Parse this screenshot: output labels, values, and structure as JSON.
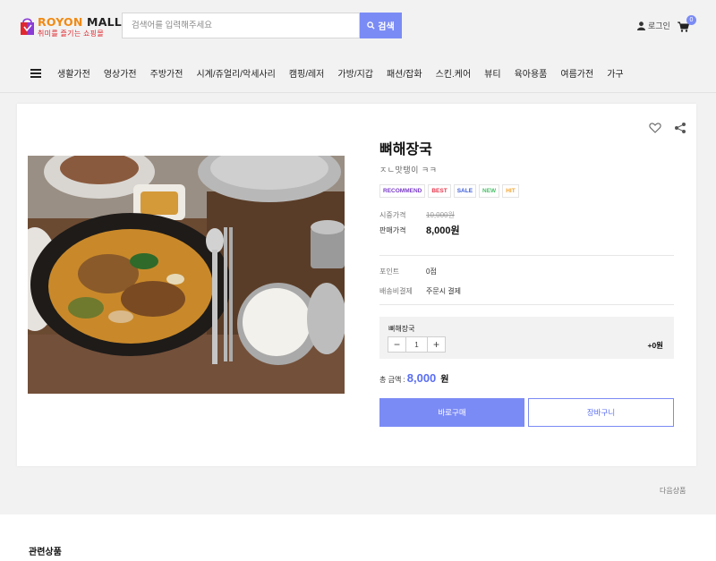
{
  "logo": {
    "title_part1": "ROYON",
    "title_part2": " MALL",
    "tagline": "취미를 즐기는 쇼핑몰"
  },
  "search": {
    "placeholder": "검색어를 입력해주세요",
    "button": "검색"
  },
  "user": {
    "login": "로그인",
    "cart_count": "0"
  },
  "nav": {
    "items": [
      "생활가전",
      "영상가전",
      "주방가전",
      "시계/쥬얼리/악세사리",
      "캠핑/레저",
      "가방/지갑",
      "패션/잡화",
      "스킨.케어",
      "뷰티",
      "육아용품",
      "여름가전",
      "가구"
    ]
  },
  "product": {
    "name": "뼈해장국",
    "subtitle": "ㅈㄴ맛탱이 ㅋㅋ",
    "badges": [
      {
        "text": "RECOMMEND",
        "color": "#7b3bc9"
      },
      {
        "text": "BEST",
        "color": "#e8344a"
      },
      {
        "text": "SALE",
        "color": "#3b5bd8"
      },
      {
        "text": "NEW",
        "color": "#4cc06a"
      },
      {
        "text": "HIT",
        "color": "#f2a533"
      }
    ],
    "market_price_label": "시중가격",
    "market_price": "10,000원",
    "sale_price_label": "판매가격",
    "sale_price": "8,000원",
    "point_label": "포인트",
    "point": "0점",
    "shipping_label": "배송비결제",
    "shipping": "주문시 결제",
    "option": {
      "name": "뼈해장국",
      "quantity": "1",
      "extra_price": "+0원"
    },
    "total_label": "총 금액 :",
    "total_amount": "8,000",
    "total_unit": "원",
    "buy_button": "바로구매",
    "cart_button": "장바구니"
  },
  "next_product": "다음상품",
  "related_title": "관련상품",
  "colors": {
    "accent": "#7b8bf5",
    "accent_text": "#5a6ef2",
    "page_bg": "#f2f2f2"
  }
}
